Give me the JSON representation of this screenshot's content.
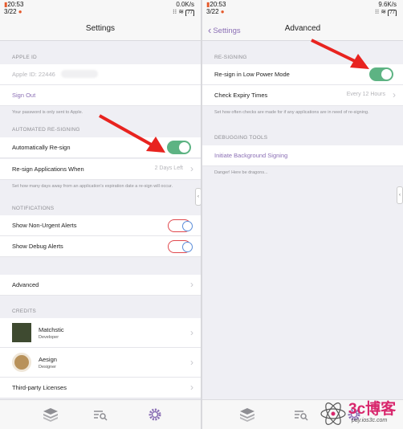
{
  "left": {
    "status": {
      "time": "20:53",
      "date": "3/22",
      "speed": "0.0K/s",
      "battery": "77"
    },
    "nav_title": "Settings",
    "apple_id": {
      "header": "APPLE ID",
      "label": "Apple ID: 22446",
      "sign_out": "Sign Out",
      "note": "Your password is only sent to Apple."
    },
    "auto_resign": {
      "header": "AUTOMATED RE-SIGNING",
      "auto_label": "Automatically Re-sign",
      "auto_on": true,
      "when_label": "Re-sign Applications When",
      "when_value": "2 Days Left",
      "note": "Set how many days away from an application's expiration date a re-sign will occur."
    },
    "notifications": {
      "header": "NOTIFICATIONS",
      "non_urgent": "Show Non-Urgent Alerts",
      "debug": "Show Debug Alerts"
    },
    "advanced_label": "Advanced",
    "credits": {
      "header": "CREDITS",
      "people": [
        {
          "name": "Matchstic",
          "role": "Developer"
        },
        {
          "name": "Aesign",
          "role": "Designer"
        }
      ],
      "licenses": "Third-party Licenses"
    }
  },
  "right": {
    "status": {
      "time": "20:53",
      "date": "3/22",
      "speed": "9.6K/s",
      "battery": "77"
    },
    "back_label": "Settings",
    "nav_title": "Advanced",
    "resign": {
      "header": "RE-SIGNING",
      "low_power": "Re-sign in Low Power Mode",
      "low_power_on": true,
      "expiry_label": "Check Expiry Times",
      "expiry_value": "Every 12 Hours",
      "note": "Set how often checks are made for if any applications are in need of re-signing."
    },
    "debug": {
      "header": "DEBUGGING TOOLS",
      "bg_signing": "Initiate Background Signing",
      "note": "Danger! Here be dragons..."
    }
  },
  "watermark": {
    "site": "3c博客",
    "url": "pay.ios3c.com"
  },
  "colors": {
    "accent": "#8b6fb5",
    "toggle_on": "#5db383",
    "arrow": "#e8231f"
  }
}
